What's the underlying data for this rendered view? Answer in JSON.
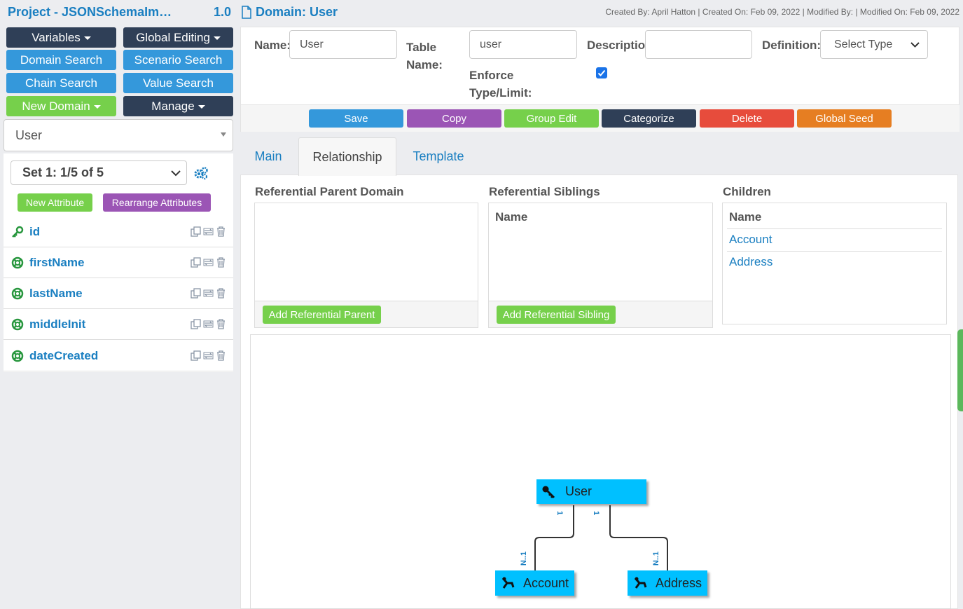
{
  "header": {
    "project_title": "Project - JSONSchemaIm…",
    "version": "1.0",
    "domain_title": "Domain: User",
    "meta_text": "Created By: April Hatton | Created On: Feb 09, 2022 | Modified By: | Modified On: Feb 09, 2022"
  },
  "sidebar": {
    "buttons": {
      "variables": "Variables",
      "global_editing": "Global Editing",
      "domain_search": "Domain Search",
      "scenario_search": "Scenario Search",
      "chain_search": "Chain Search",
      "value_search": "Value Search",
      "new_domain": "New Domain",
      "manage": "Manage"
    },
    "domain_select": "User",
    "set_select": "Set 1: 1/5 of 5",
    "new_attribute": "New Attribute",
    "rearrange_attributes": "Rearrange Attributes",
    "attributes": [
      {
        "name": "id",
        "icon": "key-icon"
      },
      {
        "name": "firstName",
        "icon": "lifebuoy-icon"
      },
      {
        "name": "lastName",
        "icon": "lifebuoy-icon"
      },
      {
        "name": "middleInit",
        "icon": "lifebuoy-icon"
      },
      {
        "name": "dateCreated",
        "icon": "lifebuoy-icon"
      }
    ]
  },
  "form": {
    "name_label": "Name:",
    "name_value": "User",
    "table_name_label": "Table Name:",
    "table_name_value": "user",
    "description_label": "Description:",
    "description_value": "",
    "definition_label": "Definition:",
    "definition_value": "Select Type",
    "enforce_label": "Enforce Type/Limit:",
    "enforce_checked": true
  },
  "actions": {
    "save": "Save",
    "copy": "Copy",
    "group_edit": "Group Edit",
    "categorize": "Categorize",
    "delete": "Delete",
    "global_seed": "Global Seed"
  },
  "tabs": [
    {
      "label": "Main",
      "active": false
    },
    {
      "label": "Relationship",
      "active": true
    },
    {
      "label": "Template",
      "active": false
    }
  ],
  "relationship": {
    "parent_title": "Referential Parent Domain",
    "siblings_title": "Referential Siblings",
    "children_title": "Children",
    "name_header": "Name",
    "add_parent": "Add Referential Parent",
    "add_sibling": "Add Referential Sibling",
    "children": [
      "Account",
      "Address"
    ]
  },
  "diagram": {
    "root": "User",
    "children": [
      "Account",
      "Address"
    ],
    "parent_multiplicity": "1",
    "child_multiplicity": "N..1",
    "node_color": "#00c0ff"
  },
  "colors": {
    "dark": "#2f3f57",
    "blue": "#3498db",
    "green": "#76d04b",
    "purple": "#9b55b5",
    "red": "#e74c3c",
    "orange": "#e67e22",
    "link": "#1a7fc1"
  }
}
